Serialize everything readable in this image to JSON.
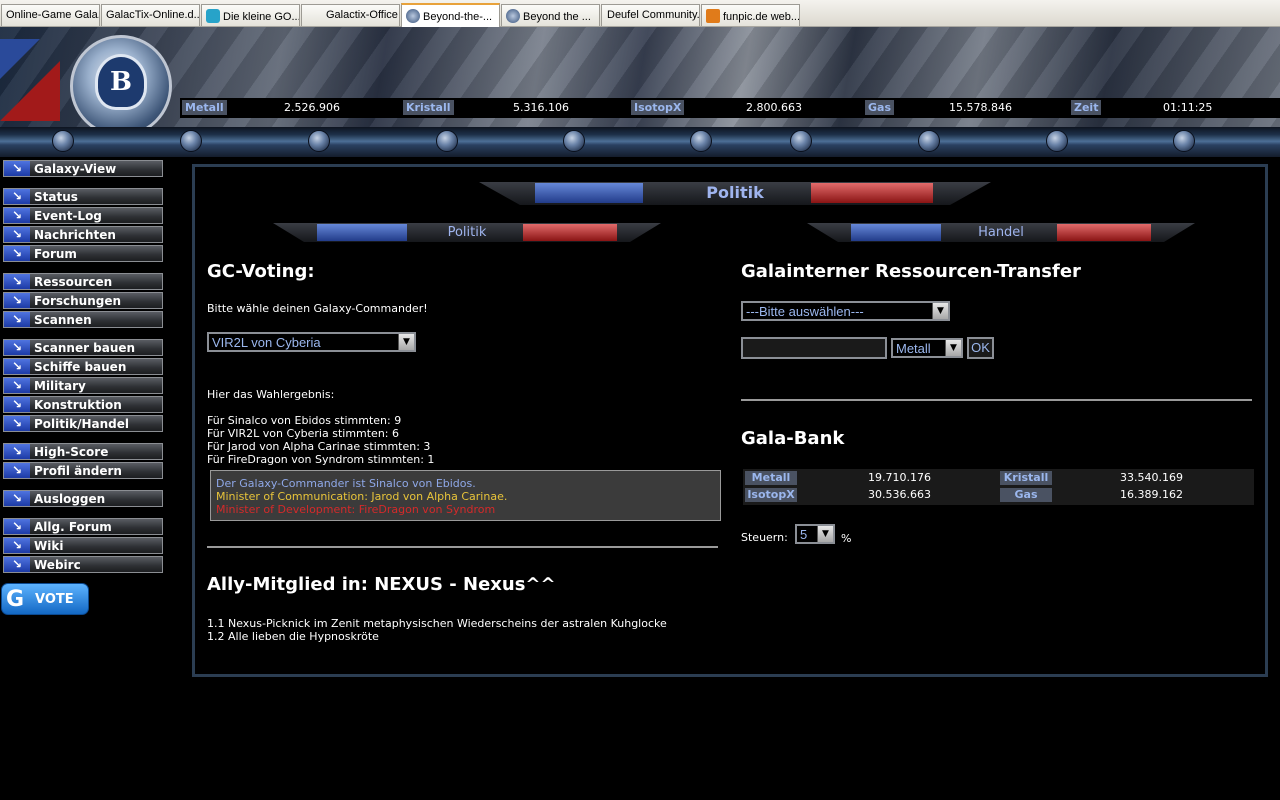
{
  "browser": {
    "tabs": [
      {
        "label": "Online-Game Gala...",
        "active": false
      },
      {
        "label": "GalacTix-Online.d...",
        "active": false
      },
      {
        "label": "Die kleine GO...",
        "active": false
      },
      {
        "label": "Galactix-Office",
        "active": false
      },
      {
        "label": "Beyond-the-...",
        "active": true
      },
      {
        "label": "Beyond the ...",
        "active": false
      },
      {
        "label": "Deufel Community...",
        "active": false
      },
      {
        "label": "funpic.de web...",
        "active": false
      }
    ]
  },
  "resources": {
    "metall_label": "Metall",
    "metall": "2.526.906",
    "kristall_label": "Kristall",
    "kristall": "5.316.106",
    "isotopx_label": "IsotopX",
    "isotopx": "2.800.663",
    "gas_label": "Gas",
    "gas": "15.578.846",
    "zeit_label": "Zeit",
    "zeit": "01:11:25"
  },
  "sidebar": {
    "items": [
      {
        "label": "Galaxy-View"
      },
      {
        "label": "Status"
      },
      {
        "label": "Event-Log"
      },
      {
        "label": "Nachrichten"
      },
      {
        "label": "Forum"
      },
      {
        "label": "Ressourcen"
      },
      {
        "label": "Forschungen"
      },
      {
        "label": "Scannen"
      },
      {
        "label": "Scanner bauen"
      },
      {
        "label": "Schiffe bauen"
      },
      {
        "label": "Military"
      },
      {
        "label": "Konstruktion"
      },
      {
        "label": "Politik/Handel"
      },
      {
        "label": "High-Score"
      },
      {
        "label": "Profil ändern"
      },
      {
        "label": "Ausloggen"
      },
      {
        "label": "Allg. Forum"
      },
      {
        "label": "Wiki"
      },
      {
        "label": "Webirc"
      }
    ],
    "vote_letter": "G",
    "vote_label": "VOTE"
  },
  "main": {
    "title": "Politik",
    "tab_politik": "Politik",
    "tab_handel": "Handel",
    "voting": {
      "heading": "GC-Voting:",
      "prompt": "Bitte wähle deinen Galaxy-Commander!",
      "selected": "VIR2L von Cyberia",
      "results_label": "Hier das Wahlergebnis:",
      "results": [
        "Für Sinalco von Ebidos stimmten: 9",
        "Für VIR2L von Cyberia stimmten: 6",
        "Für Jarod von Alpha Carinae stimmten: 3",
        "Für FireDragon von Syndrom stimmten: 1"
      ],
      "commander": "Der Galaxy-Commander ist Sinalco von Ebidos.",
      "communication": "Minister of Communication: Jarod von Alpha Carinae.",
      "development": "Minister of Development: FireDragon von Syndrom",
      "commander_color": "#8fa8e8",
      "communication_color": "#e8c43a",
      "development_color": "#d42a2a"
    },
    "ally": {
      "heading": "Ally-Mitglied in: NEXUS - Nexus^^",
      "lines": [
        "1.1 Nexus-Picknick im Zenit metaphysischen Wiederscheins der astralen Kuhglocke",
        "1.2 Alle lieben die Hypnoskröte"
      ]
    },
    "transfer": {
      "heading": "Galainterner Ressourcen-Transfer",
      "target_selected": "---Bitte auswählen---",
      "amount_value": "",
      "resource_selected": "Metall",
      "ok_label": "OK"
    },
    "bank": {
      "heading": "Gala-Bank",
      "metall_label": "Metall",
      "metall": "19.710.176",
      "kristall_label": "Kristall",
      "kristall": "33.540.169",
      "isotopx_label": "IsotopX",
      "isotopx": "30.536.663",
      "gas_label": "Gas",
      "gas": "16.389.162",
      "tax_label": "Steuern:",
      "tax_value": "5",
      "tax_unit": "%"
    }
  }
}
